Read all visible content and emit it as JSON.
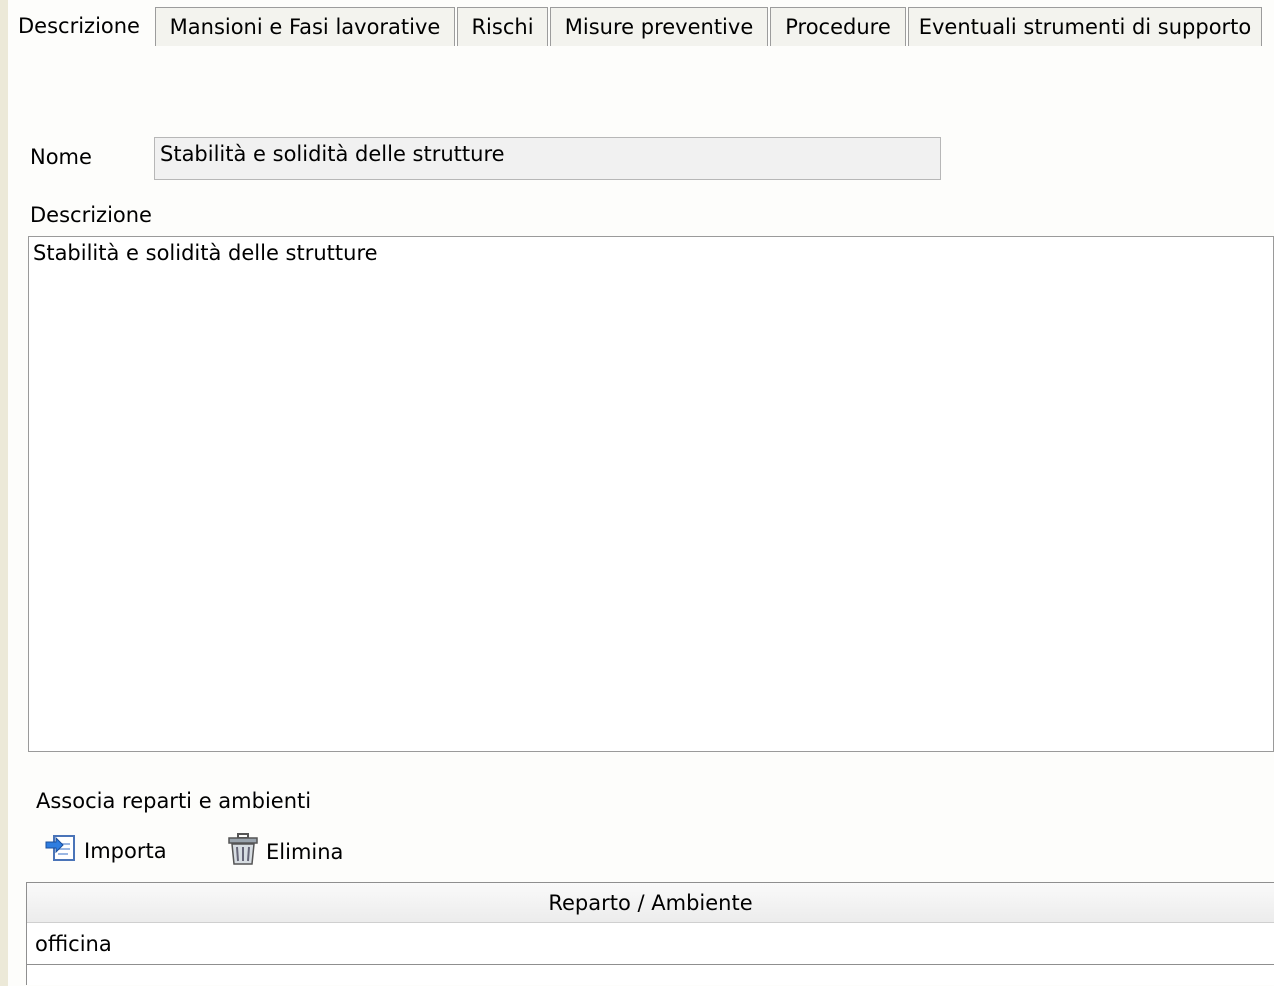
{
  "tabs": [
    {
      "label": "Descrizione",
      "active": true
    },
    {
      "label": "Mansioni e Fasi lavorative",
      "active": false
    },
    {
      "label": "Rischi",
      "active": false
    },
    {
      "label": "Misure preventive",
      "active": false
    },
    {
      "label": "Procedure",
      "active": false
    },
    {
      "label": "Eventuali strumenti di supporto",
      "active": false
    }
  ],
  "form": {
    "nome_label": "Nome",
    "nome_value": "Stabilità e solidità delle strutture",
    "descrizione_label": "Descrizione",
    "descrizione_value": "Stabilità e solidità delle strutture"
  },
  "associa": {
    "title": "Associa reparti e ambienti",
    "toolbar": {
      "import_label": "Importa",
      "import_icon": "import-icon",
      "delete_label": "Elimina",
      "delete_icon": "trash-icon"
    },
    "table": {
      "column_header": "Reparto / Ambiente",
      "rows": [
        "officina"
      ]
    }
  }
}
